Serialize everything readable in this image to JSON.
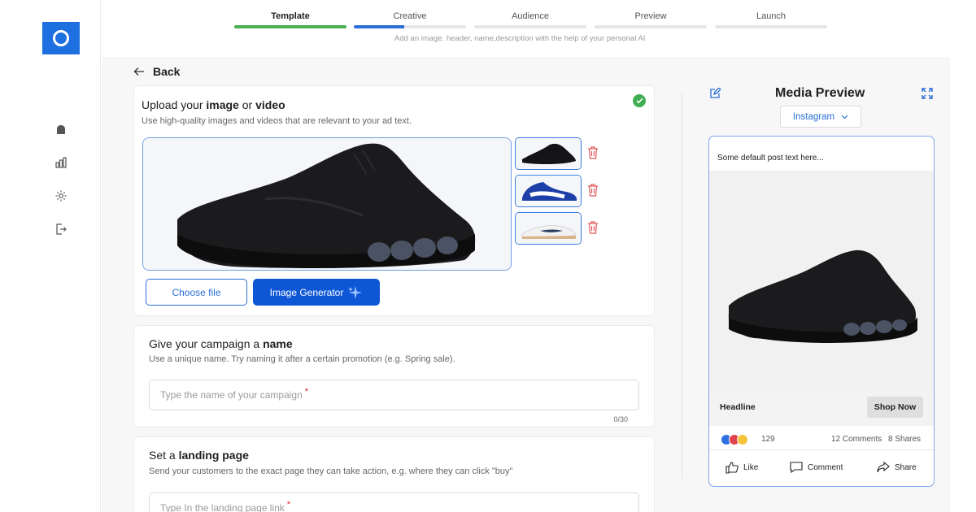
{
  "stepper": {
    "steps": [
      {
        "label": "Template",
        "state": "done"
      },
      {
        "label": "Creative",
        "state": "active"
      },
      {
        "label": "Audience",
        "state": "pending"
      },
      {
        "label": "Preview",
        "state": "pending"
      },
      {
        "label": "Launch",
        "state": "pending"
      }
    ],
    "hint": "Add an image. header, name,description with the help of your personal AI"
  },
  "sidebar": {
    "items": [
      {
        "icon": "home-icon"
      },
      {
        "icon": "chart-icon"
      },
      {
        "icon": "gear-icon"
      },
      {
        "icon": "logout-icon"
      }
    ]
  },
  "back_label": "Back",
  "upload": {
    "title_pre": "Upload your ",
    "title_b1": "image",
    "title_mid": " or ",
    "title_b2": "video",
    "desc": "Use high-quality images and videos that are relevant to your ad text.",
    "choose_label": "Choose file",
    "generator_label": "Image Generator"
  },
  "campaign": {
    "title_pre": "Give  your campaign a ",
    "title_b": "name",
    "desc": "Use a unique name. Try naming it after a certain promotion (e.g. Spring sale).",
    "placeholder": "Type the name of your campaign",
    "required": "*",
    "counter": "0/30"
  },
  "landing": {
    "title_pre": "Set a ",
    "title_b": "landing page",
    "desc": "Send your customers to the exact page they can take action, e.g. where they can click \"buy\"",
    "placeholder": "Type In the landing page link",
    "required": "*"
  },
  "preview": {
    "title": "Media Preview",
    "platform": "Instagram",
    "post_text": "Some default post text here...",
    "headline": "Headline",
    "cta": "Shop Now",
    "reaction_count": "129",
    "comments": "12 Comments",
    "shares": "8 Shares",
    "actions": {
      "like": "Like",
      "comment": "Comment",
      "share": "Share"
    }
  },
  "colors": {
    "primary": "#0d57d6",
    "accent_outline": "#2a6fd6",
    "success": "#3fae52",
    "danger": "#e0575b"
  }
}
